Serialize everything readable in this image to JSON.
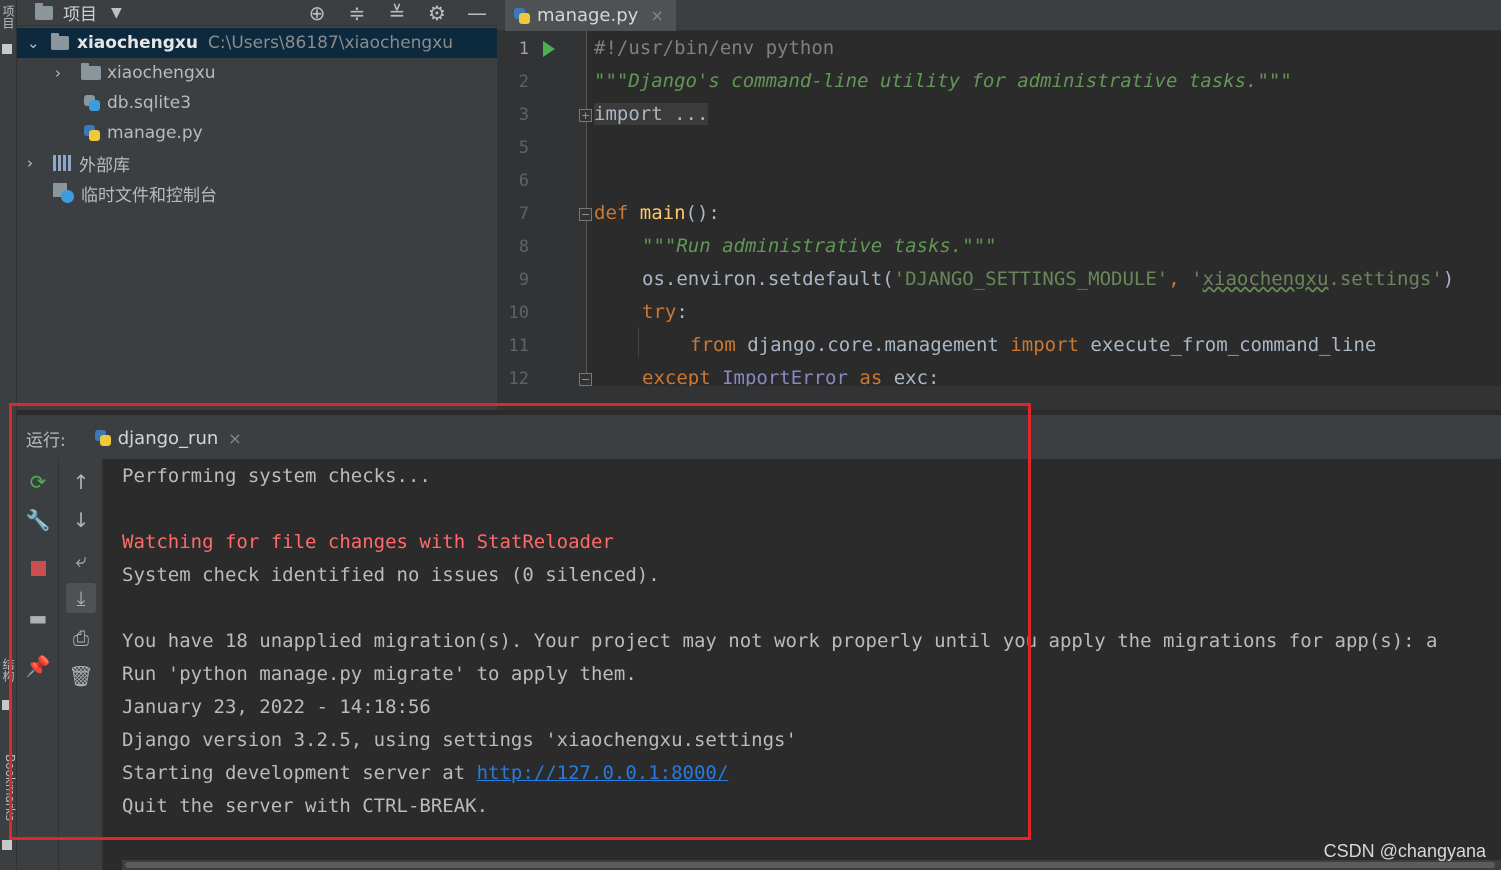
{
  "left_strip": {
    "top_label": "项目",
    "structure_label": "结构",
    "bookmarks_label": "Bookmarks"
  },
  "project_panel": {
    "title": "项目",
    "toolbar_icons": [
      "dropdown-icon",
      "locate-icon",
      "expand-all-icon",
      "collapse-all-icon",
      "gear-icon",
      "minimize-icon"
    ],
    "tree": [
      {
        "name": "xiaochengxu",
        "path": "C:\\Users\\86187\\xiaochengxu",
        "expanded": true,
        "selected": true
      },
      {
        "name": "xiaochengxu",
        "expanded": false
      },
      {
        "name": "db.sqlite3"
      },
      {
        "name": "manage.py"
      },
      {
        "name": "外部库",
        "expanded": false
      },
      {
        "name": "临时文件和控制台"
      }
    ]
  },
  "editor": {
    "tab": {
      "label": "manage.py",
      "close": "×"
    },
    "line_numbers": [
      "1",
      "2",
      "3",
      "5",
      "6",
      "7",
      "8",
      "9",
      "10",
      "11",
      "12"
    ],
    "lines": {
      "l1": "#!/usr/bin/env python",
      "l2": "\"\"\"Django's command-line utility for administrative tasks.\"\"\"",
      "l3": "import ...",
      "l7_kw": "def",
      "l7_fn": "main",
      "l7_rest": "():",
      "l8": "\"\"\"Run administrative tasks.\"\"\"",
      "l9_a": "os.environ.setdefault(",
      "l9_s1": "'DJANGO_SETTINGS_MODULE'",
      "l9_b": ", ",
      "l9_s2a": "'",
      "l9_s2b": "xiaochengxu",
      "l9_s2c": ".settings'",
      "l9_c": ")",
      "l10_kw": "try",
      "l10_rest": ":",
      "l11_kw1": "from",
      "l11_a": " django.core.management ",
      "l11_kw2": "import",
      "l11_b": " execute_from_command_line",
      "l12_kw": "except",
      "l12_cls": "ImportError",
      "l12_kw2": "as",
      "l12_rest": "exc:"
    }
  },
  "run_panel": {
    "label": "运行:",
    "tab": {
      "label": "django_run",
      "close": "×"
    },
    "console": [
      {
        "text": "Performing system checks...",
        "type": "normal"
      },
      {
        "text": "",
        "type": "normal"
      },
      {
        "text": "Watching for file changes with StatReloader",
        "type": "err"
      },
      {
        "text": "System check identified no issues (0 silenced).",
        "type": "normal"
      },
      {
        "text": "",
        "type": "normal"
      },
      {
        "text": "You have 18 unapplied migration(s). Your project may not work properly until you apply the migrations for app(s): a",
        "type": "normal"
      },
      {
        "text": "Run 'python manage.py migrate' to apply them.",
        "type": "normal"
      },
      {
        "text": "January 23, 2022 - 14:18:56",
        "type": "normal"
      },
      {
        "text": "Django version 3.2.5, using settings 'xiaochengxu.settings'",
        "type": "normal"
      },
      {
        "text": "Starting development server at ",
        "type": "normal",
        "link": "http://127.0.0.1:8000/"
      },
      {
        "text": "Quit the server with CTRL-BREAK.",
        "type": "normal"
      }
    ]
  },
  "colors": {
    "highlight_box": "#e0262b",
    "error_text": "#ff6b68",
    "link": "#287bde",
    "run_green": "#4caf50"
  },
  "watermark": "CSDN @changyana"
}
